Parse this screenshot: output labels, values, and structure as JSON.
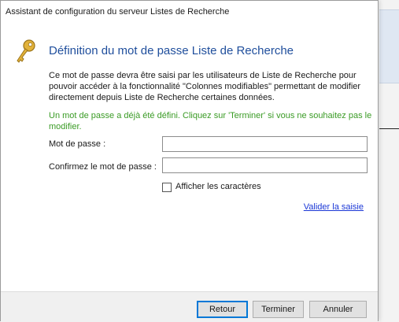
{
  "window": {
    "title": "Assistant de configuration du serveur Listes de Recherche"
  },
  "page": {
    "heading": "Définition du mot de passe Liste de Recherche",
    "description": "Ce mot de passe devra être saisi par les utilisateurs de Liste de Recherche pour pouvoir accéder à la fonctionnalité \"Colonnes modifiables\" permettant de modifier directement depuis Liste de Recherche certaines données.",
    "warning": "Un mot de passe a déjà été défini. Cliquez sur 'Terminer' si vous ne souhaitez pas le modifier."
  },
  "form": {
    "password_label": "Mot de passe :",
    "password_value": "",
    "confirm_label": "Confirmez le mot de passe :",
    "confirm_value": "",
    "show_chars_label": "Afficher les caractères",
    "show_chars_checked": false,
    "validate_link": "Valider la saisie"
  },
  "buttons": {
    "back": "Retour",
    "finish": "Terminer",
    "cancel": "Annuler"
  },
  "colors": {
    "heading": "#1f4e9c",
    "warning": "#3a9b25",
    "link": "#1a37d6",
    "default_button_border": "#0078d7"
  },
  "icons": {
    "header": "key-icon"
  }
}
